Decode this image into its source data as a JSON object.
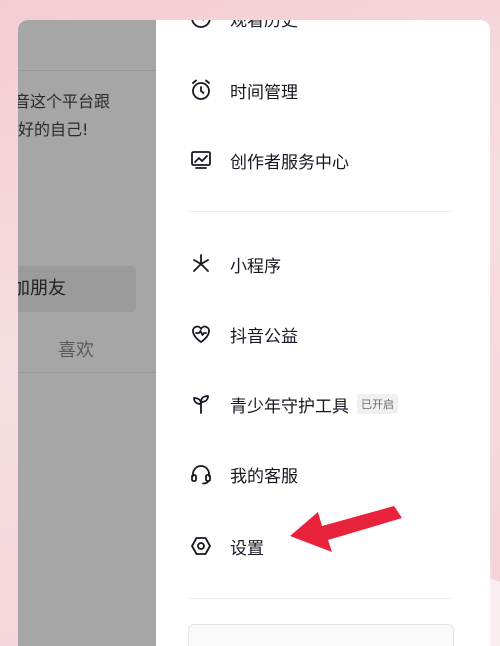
{
  "profile_behind": {
    "bio_line_1": "音这个平台跟",
    "bio_line_2": "好的自己!",
    "add_friend_label": "加朋友",
    "likes_tab_label": "喜欢"
  },
  "drawer": {
    "items": [
      {
        "label": "观看历史",
        "icon": "history-icon"
      },
      {
        "label": "时间管理",
        "icon": "alarm-clock-icon"
      },
      {
        "label": "创作者服务中心",
        "icon": "creator-chart-icon"
      },
      {
        "label": "小程序",
        "icon": "mini-program-icon"
      },
      {
        "label": "抖音公益",
        "icon": "charity-heart-icon"
      },
      {
        "label": "青少年守护工具",
        "icon": "sprout-icon",
        "badge": "已开启"
      },
      {
        "label": "我的客服",
        "icon": "headset-icon"
      },
      {
        "label": "设置",
        "icon": "settings-hexagon-icon"
      }
    ]
  },
  "colors": {
    "overlay": "#a6a6a6",
    "text": "#161823",
    "annotation_arrow": "#e8223a",
    "background_pink": "#f5d3d8"
  }
}
